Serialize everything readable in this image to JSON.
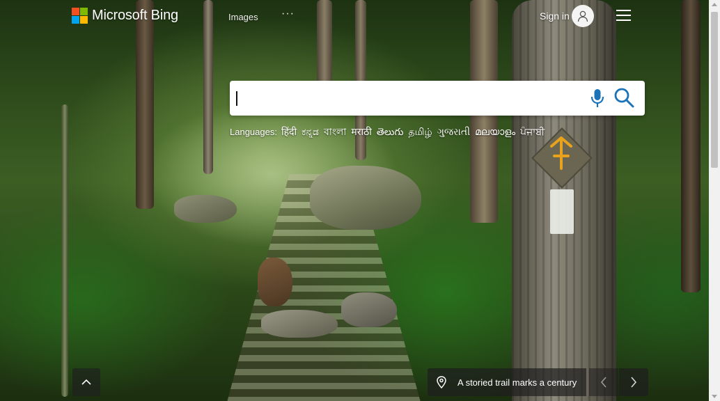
{
  "header": {
    "logo_text": "Microsoft Bing",
    "nav_images": "Images",
    "nav_more": "···",
    "sign_in": "Sign in"
  },
  "search": {
    "value": "",
    "placeholder": ""
  },
  "languages": {
    "label": "Languages:",
    "items": [
      "हिंदी",
      "ಕನ್ನಡ",
      "বাংলা",
      "मराठी",
      "తెలుగు",
      "தமிழ்",
      "ગુજરાતી",
      "മലയാളം",
      "ਪੰਜਾਬੀ"
    ]
  },
  "footer": {
    "caption": "A storied trail marks a century"
  },
  "icons": {
    "logo": "microsoft-logo-icon",
    "avatar": "user-avatar-icon",
    "menu": "hamburger-menu-icon",
    "mic": "microphone-icon",
    "search": "search-icon",
    "up": "chevron-up-icon",
    "location": "location-pin-icon",
    "prev": "chevron-left-icon",
    "next": "chevron-right-icon"
  },
  "colors": {
    "accent": "#1a73b8",
    "ms_red": "#f25022",
    "ms_green": "#7fba00",
    "ms_blue": "#00a4ef",
    "ms_yellow": "#ffb900",
    "trail_blaze": "#e8a21c"
  }
}
